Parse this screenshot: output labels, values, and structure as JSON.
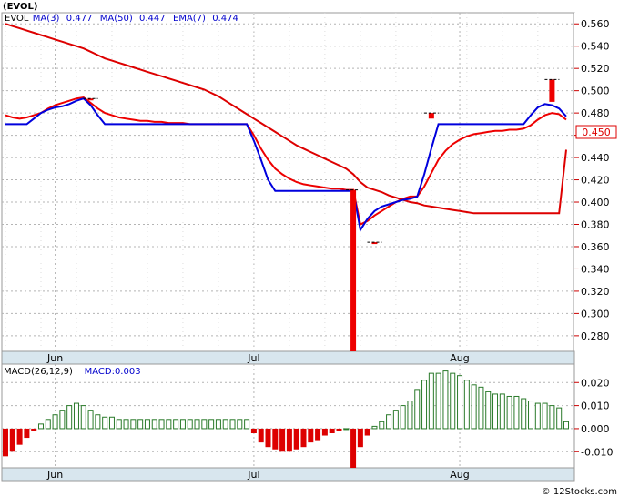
{
  "header": {
    "title": "(EVOL)"
  },
  "price_legend": [
    {
      "text": "EVOL",
      "color": "#000000"
    },
    {
      "text": "MA(3)",
      "color": "#0000cc"
    },
    {
      "text": "0.477",
      "color": "#0000cc"
    },
    {
      "text": "MA(50)",
      "color": "#0000cc"
    },
    {
      "text": "0.447",
      "color": "#0000cc"
    },
    {
      "text": "EMA(7)",
      "color": "#0000cc"
    },
    {
      "text": "0.474",
      "color": "#0000cc"
    }
  ],
  "macd_legend": [
    {
      "text": "MACD(26,12,9)",
      "color": "#000000"
    },
    {
      "text": "MACD:0.003",
      "color": "#0000cc"
    }
  ],
  "last_price_label": "0.450",
  "footer": "© 12Stocks.com",
  "colors": {
    "ma3": "#0000dd",
    "ma50": "#dd0000",
    "ema7": "#ee0000",
    "candle": "#ee0000",
    "macd_up": "#2a7a2a",
    "macd_down": "#dd0000",
    "grid": "#b4b4b4",
    "axis_bg": "#d8e6ee",
    "tick_mark": "#cc0000"
  },
  "chart_data": [
    {
      "type": "line",
      "title": "(EVOL)",
      "x_axis": {
        "ticks": [
          "Jun",
          "Jul",
          "Aug"
        ],
        "tick_sessions": [
          7,
          35,
          64
        ]
      },
      "y_axis": {
        "ticks": [
          0.28,
          0.3,
          0.32,
          0.34,
          0.36,
          0.38,
          0.4,
          0.42,
          0.44,
          0.46,
          0.48,
          0.5,
          0.52,
          0.54,
          0.56
        ],
        "ylim": [
          0.266,
          0.57
        ]
      },
      "grid": true,
      "x": [
        0,
        1,
        2,
        3,
        4,
        5,
        6,
        7,
        8,
        9,
        10,
        11,
        12,
        13,
        14,
        15,
        16,
        17,
        18,
        19,
        20,
        21,
        22,
        23,
        24,
        25,
        26,
        27,
        28,
        29,
        30,
        31,
        32,
        33,
        34,
        35,
        36,
        37,
        38,
        39,
        40,
        41,
        42,
        43,
        44,
        45,
        46,
        47,
        48,
        49,
        50,
        51,
        52,
        53,
        54,
        55,
        56,
        57,
        58,
        59,
        60,
        61,
        62,
        63,
        64,
        65,
        66,
        67,
        68,
        69,
        70,
        71,
        72,
        73,
        74,
        75,
        76,
        77,
        78,
        79
      ],
      "series": [
        {
          "name": "MA(3)",
          "values": [
            0.47,
            0.47,
            0.47,
            0.47,
            0.475,
            0.48,
            0.483,
            0.485,
            0.486,
            0.488,
            0.491,
            0.493,
            0.487,
            0.478,
            0.47,
            0.47,
            0.47,
            0.47,
            0.47,
            0.47,
            0.47,
            0.47,
            0.47,
            0.47,
            0.47,
            0.47,
            0.47,
            0.47,
            0.47,
            0.47,
            0.47,
            0.47,
            0.47,
            0.47,
            0.47,
            0.455,
            0.438,
            0.42,
            0.41,
            0.41,
            0.41,
            0.41,
            0.41,
            0.41,
            0.41,
            0.41,
            0.41,
            0.41,
            0.41,
            0.41,
            0.375,
            0.385,
            0.392,
            0.396,
            0.398,
            0.4,
            0.402,
            0.403,
            0.405,
            0.425,
            0.448,
            0.47,
            0.47,
            0.47,
            0.47,
            0.47,
            0.47,
            0.47,
            0.47,
            0.47,
            0.47,
            0.47,
            0.47,
            0.47,
            0.478,
            0.485,
            0.488,
            0.487,
            0.484,
            0.477
          ]
        },
        {
          "name": "MA(50)",
          "values": [
            0.56,
            0.558,
            0.556,
            0.554,
            0.552,
            0.55,
            0.548,
            0.546,
            0.544,
            0.542,
            0.54,
            0.538,
            0.535,
            0.532,
            0.529,
            0.527,
            0.525,
            0.523,
            0.521,
            0.519,
            0.517,
            0.515,
            0.513,
            0.511,
            0.509,
            0.507,
            0.505,
            0.503,
            0.501,
            0.498,
            0.495,
            0.491,
            0.487,
            0.483,
            0.479,
            0.475,
            0.471,
            0.467,
            0.463,
            0.459,
            0.455,
            0.451,
            0.448,
            0.445,
            0.442,
            0.439,
            0.436,
            0.433,
            0.43,
            0.425,
            0.418,
            0.413,
            0.411,
            0.409,
            0.406,
            0.404,
            0.402,
            0.4,
            0.399,
            0.397,
            0.396,
            0.395,
            0.394,
            0.393,
            0.392,
            0.391,
            0.39,
            0.39,
            0.39,
            0.39,
            0.39,
            0.39,
            0.39,
            0.39,
            0.39,
            0.39,
            0.39,
            0.39,
            0.39,
            0.447
          ]
        },
        {
          "name": "EMA(7)",
          "values": [
            0.478,
            0.476,
            0.475,
            0.476,
            0.478,
            0.48,
            0.484,
            0.487,
            0.489,
            0.491,
            0.493,
            0.494,
            0.489,
            0.484,
            0.48,
            0.478,
            0.476,
            0.475,
            0.474,
            0.473,
            0.473,
            0.472,
            0.472,
            0.471,
            0.471,
            0.471,
            0.47,
            0.47,
            0.47,
            0.47,
            0.47,
            0.47,
            0.47,
            0.47,
            0.47,
            0.46,
            0.448,
            0.438,
            0.43,
            0.425,
            0.421,
            0.418,
            0.416,
            0.415,
            0.414,
            0.413,
            0.412,
            0.412,
            0.411,
            0.411,
            0.38,
            0.383,
            0.388,
            0.392,
            0.396,
            0.4,
            0.403,
            0.405,
            0.405,
            0.414,
            0.426,
            0.438,
            0.446,
            0.452,
            0.456,
            0.459,
            0.461,
            0.462,
            0.463,
            0.464,
            0.464,
            0.465,
            0.465,
            0.466,
            0.469,
            0.474,
            0.478,
            0.48,
            0.479,
            0.474
          ]
        }
      ],
      "price_bars": [
        {
          "x": 12,
          "open": 0.493,
          "close": 0.493,
          "high": 0.493,
          "low": 0.493
        },
        {
          "x": 49,
          "open": 0.411,
          "close": 0.266,
          "high": 0.411,
          "low": 0.266
        },
        {
          "x": 52,
          "open": 0.364,
          "close": 0.364,
          "high": 0.364,
          "low": 0.364
        },
        {
          "x": 60,
          "open": 0.48,
          "close": 0.475,
          "high": 0.48,
          "low": 0.475
        },
        {
          "x": 77,
          "open": 0.51,
          "close": 0.49,
          "high": 0.51,
          "low": 0.49
        }
      ],
      "last_price": 0.45
    },
    {
      "type": "bar",
      "title": "MACD(26,12,9)",
      "x_axis": {
        "ticks": [
          "Jun",
          "Jul",
          "Aug"
        ],
        "tick_sessions": [
          7,
          35,
          64
        ]
      },
      "y_axis": {
        "ticks": [
          -0.01,
          0.0,
          0.01,
          0.02
        ],
        "ylim": [
          -0.017,
          0.028
        ]
      },
      "grid": true,
      "x": [
        0,
        1,
        2,
        3,
        4,
        5,
        6,
        7,
        8,
        9,
        10,
        11,
        12,
        13,
        14,
        15,
        16,
        17,
        18,
        19,
        20,
        21,
        22,
        23,
        24,
        25,
        26,
        27,
        28,
        29,
        30,
        31,
        32,
        33,
        34,
        35,
        36,
        37,
        38,
        39,
        40,
        41,
        42,
        43,
        44,
        45,
        46,
        47,
        48,
        49,
        50,
        51,
        52,
        53,
        54,
        55,
        56,
        57,
        58,
        59,
        60,
        61,
        62,
        63,
        64,
        65,
        66,
        67,
        68,
        69,
        70,
        71,
        72,
        73,
        74,
        75,
        76,
        77,
        78,
        79
      ],
      "values": [
        -0.012,
        -0.01,
        -0.007,
        -0.004,
        -0.001,
        0.002,
        0.004,
        0.006,
        0.008,
        0.01,
        0.011,
        0.01,
        0.008,
        0.006,
        0.005,
        0.005,
        0.004,
        0.004,
        0.004,
        0.004,
        0.004,
        0.004,
        0.004,
        0.004,
        0.004,
        0.004,
        0.004,
        0.004,
        0.004,
        0.004,
        0.004,
        0.004,
        0.004,
        0.004,
        0.004,
        -0.002,
        -0.006,
        -0.008,
        -0.009,
        -0.01,
        -0.01,
        -0.009,
        -0.008,
        -0.006,
        -0.005,
        -0.003,
        -0.002,
        -0.001,
        0.0,
        -0.017,
        -0.008,
        -0.003,
        0.001,
        0.003,
        0.006,
        0.008,
        0.01,
        0.012,
        0.017,
        0.021,
        0.024,
        0.024,
        0.025,
        0.024,
        0.023,
        0.021,
        0.019,
        0.018,
        0.016,
        0.015,
        0.015,
        0.014,
        0.014,
        0.013,
        0.012,
        0.011,
        0.011,
        0.01,
        0.009,
        0.003
      ]
    }
  ]
}
